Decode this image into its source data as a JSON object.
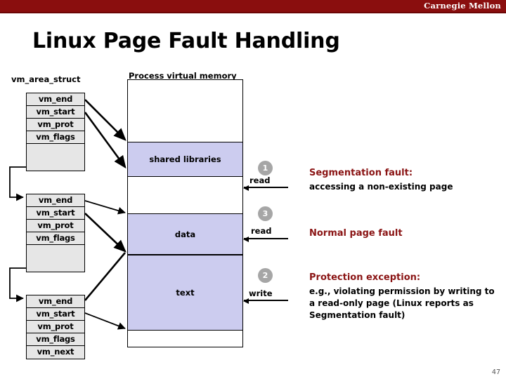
{
  "banner": {
    "brand": "Carnegie Mellon",
    "color": "#8a0e0e"
  },
  "slide": {
    "title": "Linux Page Fault Handling",
    "page_number": "47"
  },
  "labels": {
    "struct_label": "vm_area_struct",
    "vm_label": "Process virtual memory"
  },
  "structs": [
    {
      "fields": [
        "vm_end",
        "vm_start",
        "vm_prot",
        "vm_flags"
      ]
    },
    {
      "fields": [
        "vm_end",
        "vm_start",
        "vm_prot",
        "vm_flags"
      ]
    },
    {
      "fields": [
        "vm_end",
        "vm_start",
        "vm_prot",
        "vm_flags",
        "vm_next"
      ]
    }
  ],
  "memory_segments": [
    {
      "name": "shared libraries",
      "color": "#ccccef"
    },
    {
      "name": "data",
      "color": "#ccccef"
    },
    {
      "name": "text",
      "color": "#ccccef"
    }
  ],
  "accesses": [
    {
      "number": "1",
      "op": "read"
    },
    {
      "number": "3",
      "op": "read"
    },
    {
      "number": "2",
      "op": "write"
    }
  ],
  "notes": [
    {
      "heading": "Segmentation fault:",
      "body": "accessing a non-existing page"
    },
    {
      "heading": "Normal page fault",
      "body": ""
    },
    {
      "heading": "Protection exception:",
      "body": "e.g., violating permission by writing to a read-only page (Linux reports as Segmentation fault)"
    }
  ],
  "colors": {
    "accent_red": "#8a1414",
    "struct_fill": "#e6e6e6",
    "segment_fill": "#ccccef",
    "circle_fill": "#a6a6a6"
  }
}
